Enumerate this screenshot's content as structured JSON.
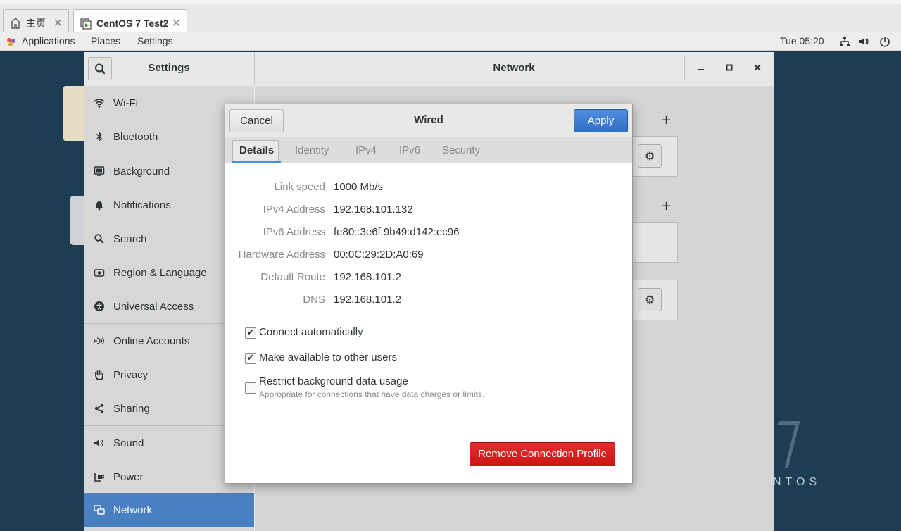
{
  "vm_tabs": [
    {
      "label": "主页",
      "icon": "home-icon"
    },
    {
      "label": "CentOS 7 Test2",
      "icon": "vm-icon"
    }
  ],
  "topbar": {
    "applications": "Applications",
    "places": "Places",
    "settings": "Settings",
    "clock": "Tue 05:20"
  },
  "settings": {
    "left_title": "Settings",
    "right_title": "Network",
    "sidebar": [
      {
        "label": "Wi-Fi",
        "icon": "wifi-icon"
      },
      {
        "label": "Bluetooth",
        "icon": "bluetooth-icon"
      },
      {
        "label": "Background",
        "icon": "background-icon"
      },
      {
        "label": "Notifications",
        "icon": "bell-icon"
      },
      {
        "label": "Search",
        "icon": "search-icon"
      },
      {
        "label": "Region & Language",
        "icon": "camera-icon"
      },
      {
        "label": "Universal Access",
        "icon": "accessibility-icon"
      },
      {
        "label": "Online Accounts",
        "icon": "online-accounts-icon"
      },
      {
        "label": "Privacy",
        "icon": "hand-icon"
      },
      {
        "label": "Sharing",
        "icon": "share-icon"
      },
      {
        "label": "Sound",
        "icon": "speaker-icon"
      },
      {
        "label": "Power",
        "icon": "power-plug-icon"
      },
      {
        "label": "Network",
        "icon": "network-icon",
        "active": true
      }
    ]
  },
  "dialog": {
    "cancel": "Cancel",
    "title": "Wired",
    "apply": "Apply",
    "tabs": [
      "Details",
      "Identity",
      "IPv4",
      "IPv6",
      "Security"
    ],
    "active_tab": "Details",
    "details": [
      {
        "label": "Link speed",
        "value": "1000 Mb/s"
      },
      {
        "label": "IPv4 Address",
        "value": "192.168.101.132"
      },
      {
        "label": "IPv6 Address",
        "value": "fe80::3e6f:9b49:d142:ec96"
      },
      {
        "label": "Hardware Address",
        "value": "00:0C:29:2D:A0:69"
      },
      {
        "label": "Default Route",
        "value": "192.168.101.2"
      },
      {
        "label": "DNS",
        "value": "192.168.101.2"
      }
    ],
    "checkboxes": [
      {
        "label": "Connect automatically",
        "checked": true
      },
      {
        "label": "Make available to other users",
        "checked": true
      },
      {
        "label": "Restrict background data usage",
        "checked": false,
        "sub": "Appropriate for connections that have data charges or limits."
      }
    ],
    "remove": "Remove Connection Profile"
  },
  "colors": {
    "accent": "#4a7fc1",
    "apply": "#3b7fd4",
    "danger": "#d41f1f"
  }
}
